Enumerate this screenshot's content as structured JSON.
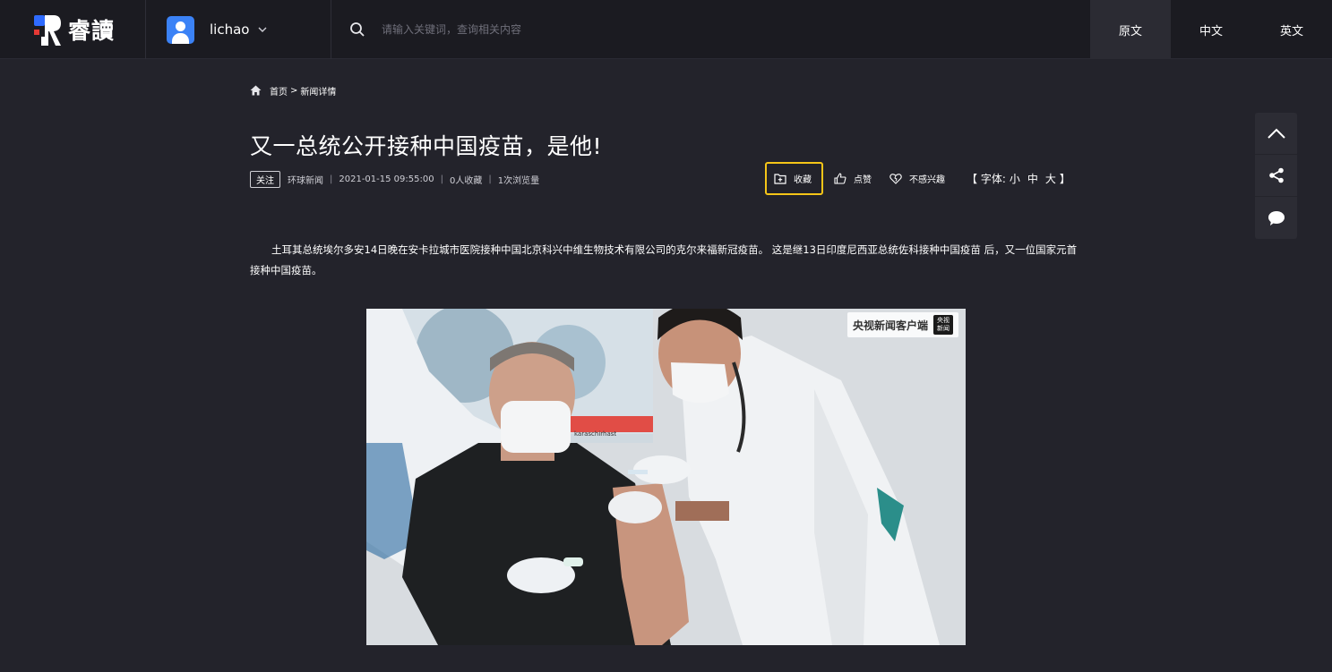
{
  "brand": {
    "logo_text": "睿讀"
  },
  "user": {
    "name": "lichao"
  },
  "search": {
    "placeholder": "请输入关键词，查询相关内容"
  },
  "lang_tabs": [
    {
      "label": "原文",
      "active": true
    },
    {
      "label": "中文",
      "active": false
    },
    {
      "label": "英文",
      "active": false
    }
  ],
  "breadcrumb": {
    "home": "首页",
    "separator": ">",
    "current": "新闻详情"
  },
  "article": {
    "title": "又一总统公开接种中国疫苗，是他!",
    "follow_label": "关注",
    "source": "环球新闻",
    "datetime": "2021-01-15 09:55:00",
    "collect_count": "0人收藏",
    "view_count": "1次浏览量",
    "body": "土耳其总统埃尔多安14日晚在安卡拉城市医院接种中国北京科兴中维生物技术有限公司的克尔来福新冠疫苗。 这是继13日印度尼西亚总统佐科接种中国疫苗 后，又一位国家元首接种中国疫苗。"
  },
  "actions": {
    "collect": "收藏",
    "like": "点赞",
    "not_interested": "不感兴趣",
    "font_label": "【 字体:",
    "font_small": "小",
    "font_medium": "中",
    "font_large": "大",
    "font_close": "】"
  },
  "photo": {
    "watermark": "央视新闻客户端",
    "badge": "央视新闻",
    "poster_caption": "karaschirhast"
  },
  "float_tools": [
    "chevron-up-icon",
    "share-icon",
    "comment-icon"
  ],
  "colors": {
    "background": "#23232b",
    "header": "#1b1b21",
    "accent_border": "#f5c518",
    "avatar": "#3b82f6",
    "logo_red": "#e53935",
    "logo_blue": "#2f6bff"
  }
}
